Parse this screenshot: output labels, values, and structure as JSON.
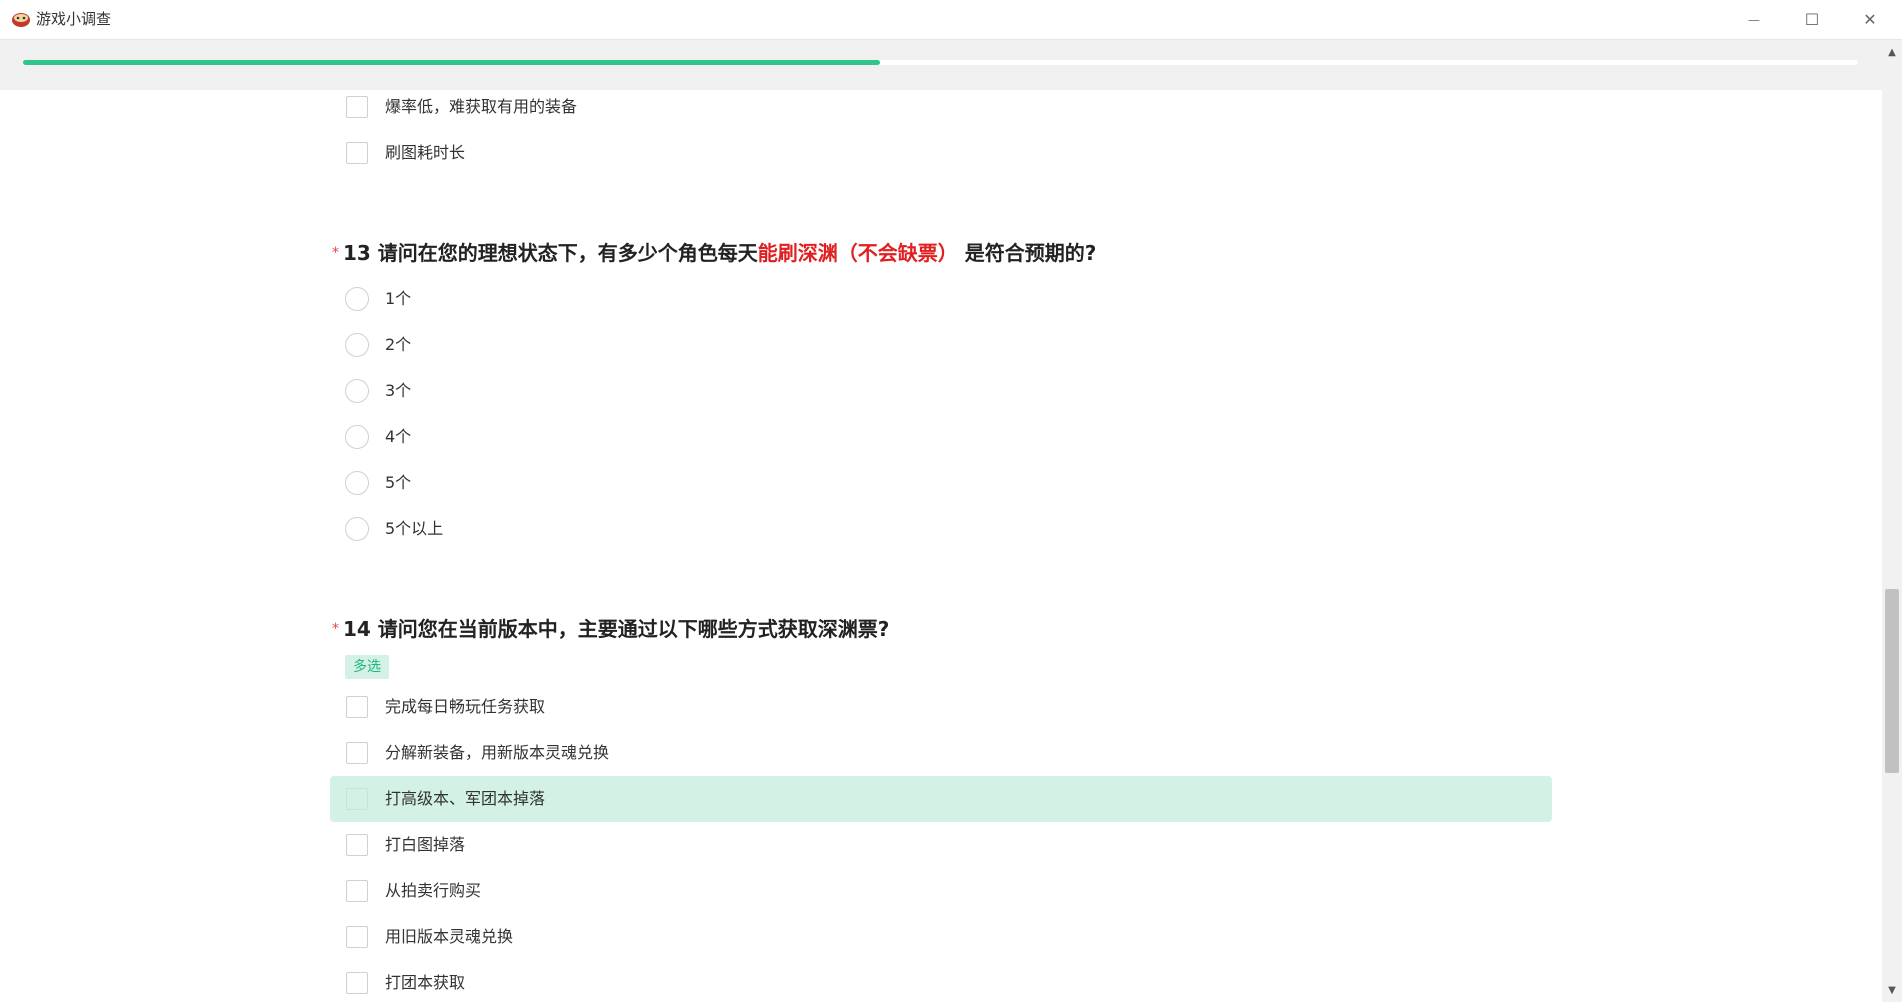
{
  "window": {
    "title": "游戏小调查",
    "min_glyph": "—",
    "max_glyph": "☐",
    "close_glyph": "✕"
  },
  "progress": {
    "fraction": 0.467
  },
  "scroll": {
    "up_glyph": "▲",
    "down_glyph": "▼"
  },
  "prev_question": {
    "options": [
      "爆率低，难获取有用的装备",
      "刷图耗时长"
    ]
  },
  "q13": {
    "required_mark": "*",
    "number_prefix": "13 请问在您的理想状态下，有多少个角色每天",
    "highlight": "能刷深渊（不会缺票）",
    "suffix": "是符合预期的?",
    "options": [
      "1个",
      "2个",
      "3个",
      "4个",
      "5个",
      "5个以上"
    ]
  },
  "q14": {
    "required_mark": "*",
    "text": "14 请问您在当前版本中，主要通过以下哪些方式获取深渊票?",
    "tag": "多选",
    "options": [
      "完成每日畅玩任务获取",
      "分解新装备，用新版本灵魂兑换",
      "打高级本、军团本掉落",
      "打白图掉落",
      "从拍卖行购买",
      "用旧版本灵魂兑换",
      "打团本获取"
    ],
    "hovered_index": 2
  },
  "colors": {
    "accent": "#2ec48a",
    "highlight_bg": "#d3f2e5",
    "required": "#e64340",
    "emphasis": "#e02020"
  }
}
